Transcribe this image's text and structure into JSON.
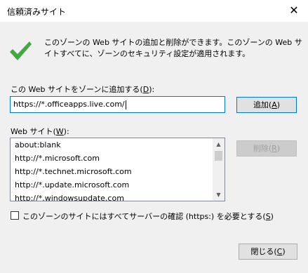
{
  "window": {
    "title": "信頼済みサイト",
    "close_glyph": "✕"
  },
  "description": "このゾーンの Web サイトの追加と削除ができます。このゾーンの Web サイトすべてに、ゾーンのセキュリティ設定が適用されます。",
  "add_section": {
    "label_text": "この Web サイトをゾーンに追加する(",
    "label_key": "D",
    "label_end": "):",
    "input_value": "https://*.officeapps.live.com/",
    "add_button_text": "追加(",
    "add_button_key": "A",
    "add_button_end": ")"
  },
  "sites_section": {
    "label_text": "Web サイト(",
    "label_key": "W",
    "label_end": "):",
    "items": [
      "about:blank",
      "http://*.microsoft.com",
      "http://*.technet.microsoft.com",
      "http://*.update.microsoft.com",
      "http://*.windowsupdate.com"
    ],
    "remove_button_text": "削除(",
    "remove_button_key": "R",
    "remove_button_end": ")"
  },
  "https_checkbox": {
    "checked": false,
    "label_text": "このゾーンのサイトにはすべてサーバーの確認 (https:) を必要とする(",
    "label_key": "S",
    "label_end": ")"
  },
  "close_button": {
    "text": "閉じる(",
    "key": "C",
    "end": ")"
  },
  "icons": {
    "check": "check-icon",
    "scroll_up": "▲",
    "scroll_down": "▼"
  },
  "colors": {
    "accent": "#0078d7",
    "check_green": "#43a843",
    "dialog_bg": "#f0f0f0"
  }
}
